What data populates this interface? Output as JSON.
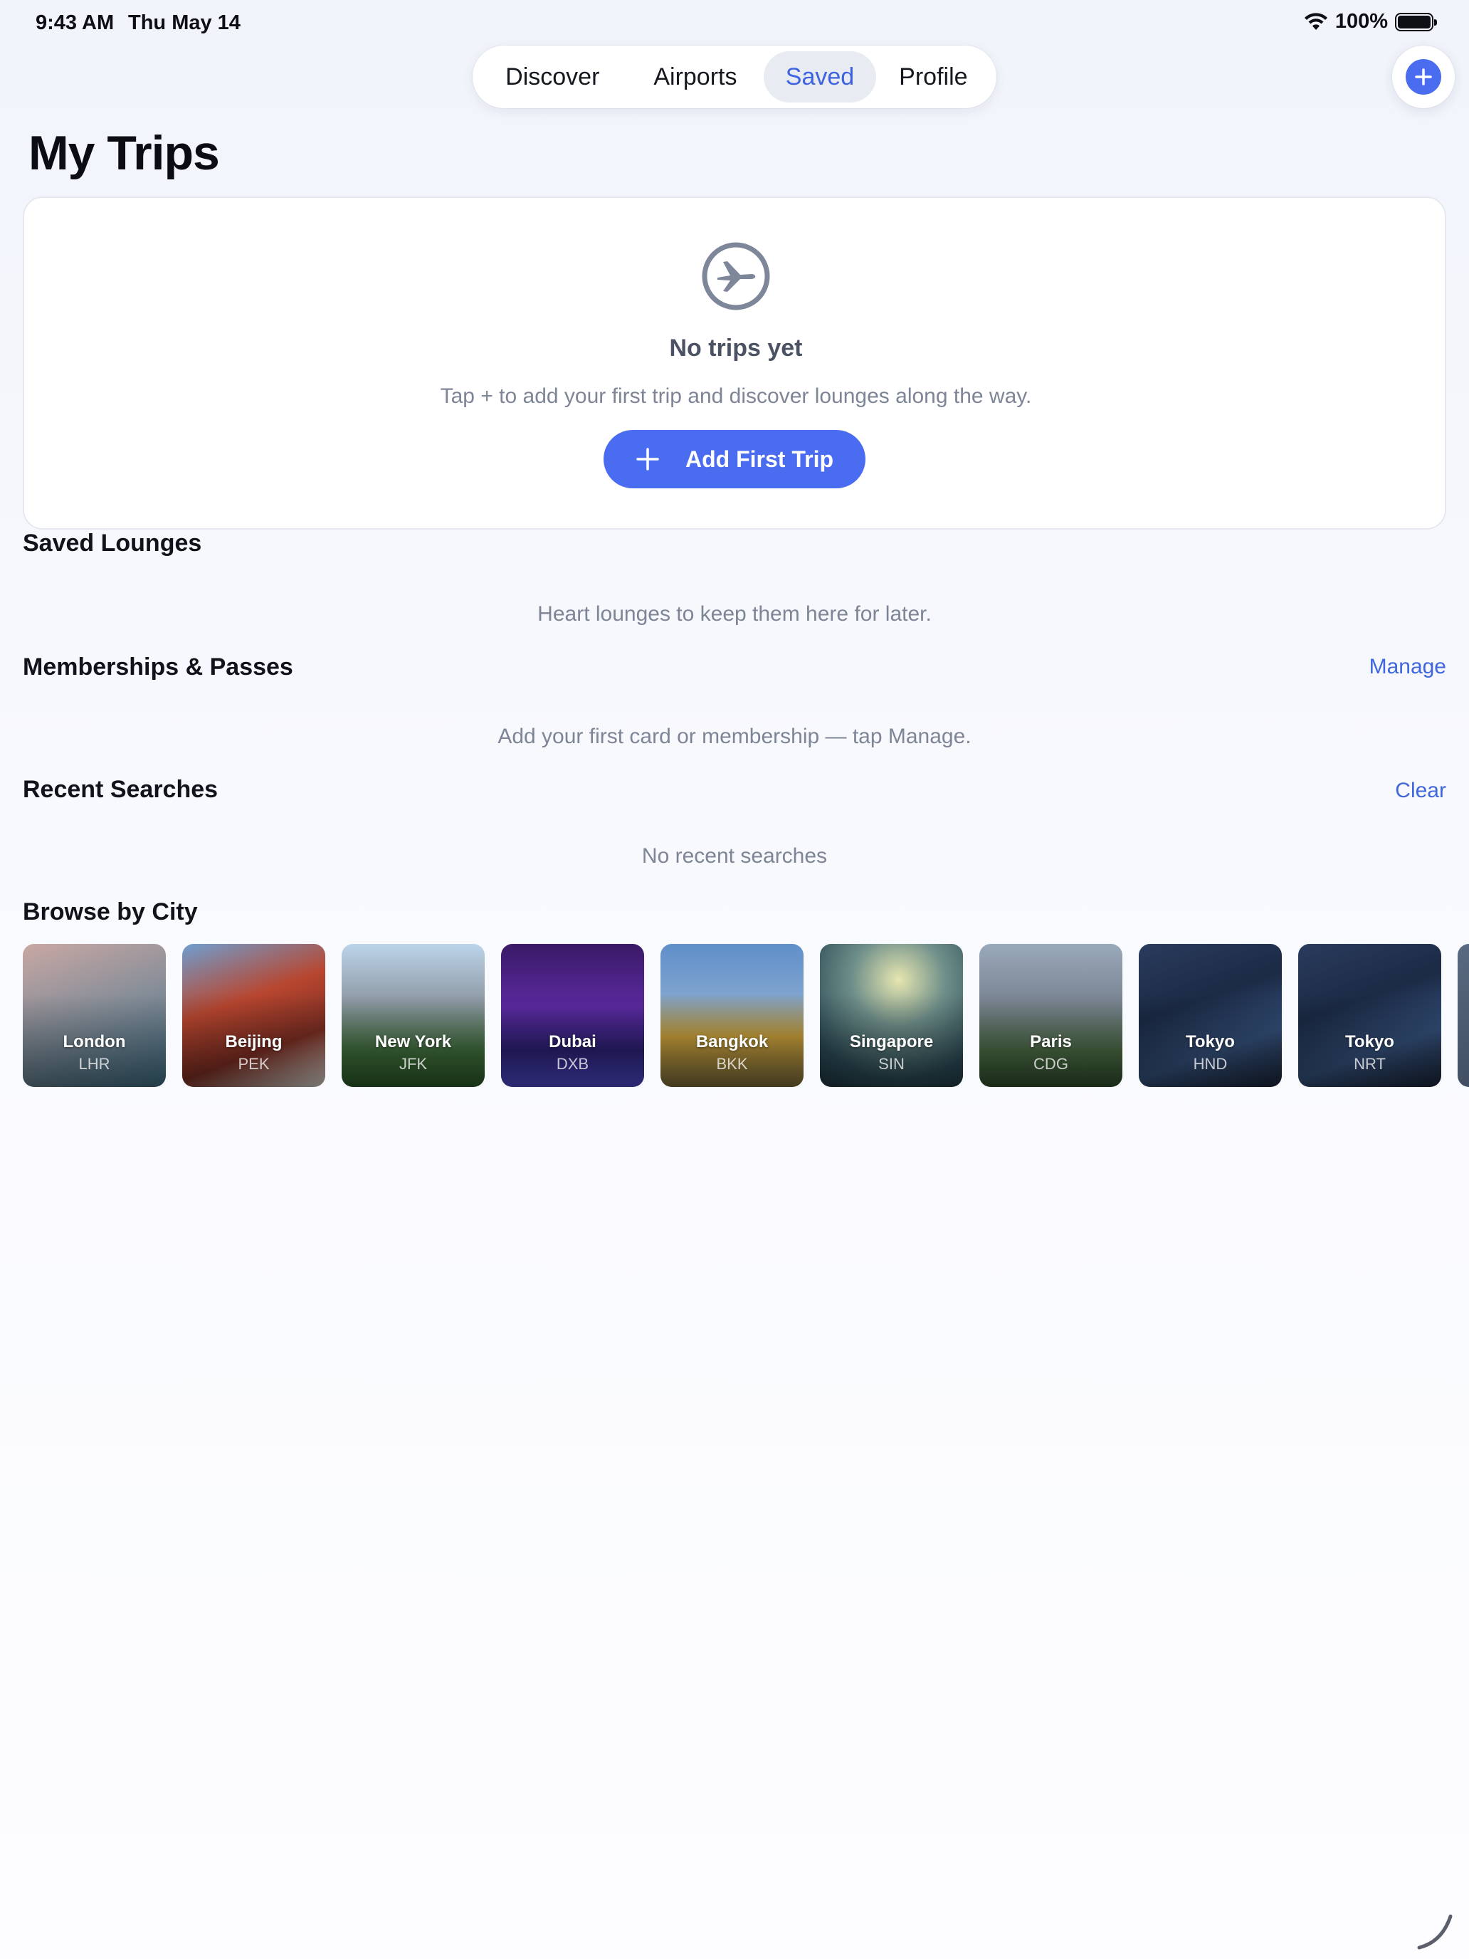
{
  "status_bar": {
    "time": "9:43 AM",
    "date": "Thu May 14",
    "battery": "100%"
  },
  "tabs": [
    {
      "label": "Discover"
    },
    {
      "label": "Airports"
    },
    {
      "label": "Saved"
    },
    {
      "label": "Profile"
    }
  ],
  "selected_tab": "Saved",
  "page_title": "My Trips",
  "trip_card": {
    "icon": "airplane-circle-icon",
    "title": "No trips yet",
    "subtitle": "Tap + to add your first trip and discover lounges along the way.",
    "button_label": "Add First Trip"
  },
  "saved_lounges": {
    "title": "Saved Lounges",
    "empty": "Heart lounges to keep them here for later."
  },
  "memberships": {
    "title": "Memberships & Passes",
    "action": "Manage",
    "empty": "Add your first card or membership — tap Manage."
  },
  "recent_searches": {
    "title": "Recent Searches",
    "action": "Clear",
    "empty": "No recent searches"
  },
  "browse": {
    "title": "Browse by City",
    "cities": [
      {
        "name": "London",
        "code": "LHR"
      },
      {
        "name": "Beijing",
        "code": "PEK"
      },
      {
        "name": "New York",
        "code": "JFK"
      },
      {
        "name": "Dubai",
        "code": "DXB"
      },
      {
        "name": "Bangkok",
        "code": "BKK"
      },
      {
        "name": "Singapore",
        "code": "SIN"
      },
      {
        "name": "Paris",
        "code": "CDG"
      },
      {
        "name": "Tokyo",
        "code": "HND"
      },
      {
        "name": "Tokyo",
        "code": "NRT"
      }
    ]
  },
  "colors": {
    "accent": "#4a6cf0",
    "link": "#4066dd",
    "muted": "#7d8596"
  }
}
